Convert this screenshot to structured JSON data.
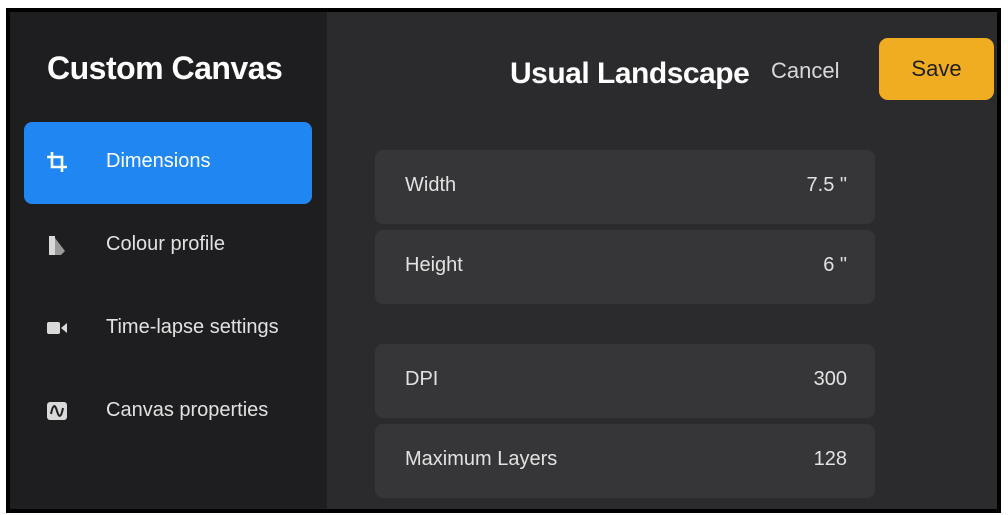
{
  "sidebar": {
    "title": "Custom Canvas",
    "items": [
      {
        "label": "Dimensions",
        "icon": "crop-icon",
        "active": true
      },
      {
        "label": "Colour profile",
        "icon": "colour-profile-icon",
        "active": false
      },
      {
        "label": "Time-lapse settings",
        "icon": "video-camera-icon",
        "active": false
      },
      {
        "label": "Canvas properties",
        "icon": "canvas-properties-icon",
        "active": false
      }
    ]
  },
  "header": {
    "title": "Usual Landscape",
    "cancel_label": "Cancel",
    "save_label": "Save"
  },
  "dimensions": {
    "rows": [
      {
        "label": "Width",
        "value": "7.5 \""
      },
      {
        "label": "Height",
        "value": "6 \""
      },
      {
        "label": "DPI",
        "value": "300"
      },
      {
        "label": "Maximum Layers",
        "value": "128"
      }
    ]
  },
  "colors": {
    "accent": "#1f86f2",
    "save_button": "#f0ad22",
    "background": "#2b2b2d",
    "sidebar_background": "#1e1e20",
    "row_background": "#363638"
  }
}
